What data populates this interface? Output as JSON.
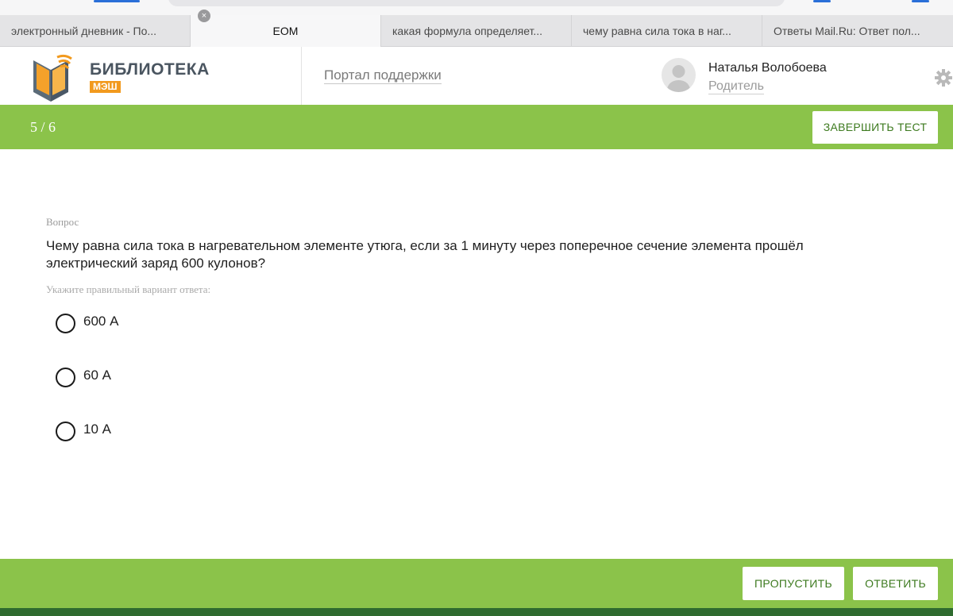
{
  "browser": {
    "tabs": [
      {
        "label": "электронный дневник - По..."
      },
      {
        "label": "ЕОМ"
      },
      {
        "label": "какая формула определяет..."
      },
      {
        "label": "чему равна сила тока в наг..."
      },
      {
        "label": "Ответы Mail.Ru: Ответ пол..."
      }
    ],
    "close_glyph": "×"
  },
  "header": {
    "logo_title": "БИБЛИОТЕКА",
    "logo_subtitle": "МЭШ",
    "support_link": "Портал поддержки",
    "user_name": "Наталья Волобоева",
    "user_role": "Родитель"
  },
  "test": {
    "progress": "5 / 6",
    "finish_label": "ЗАВЕРШИТЬ ТЕСТ"
  },
  "question": {
    "caption": "Вопрос",
    "text": "Чему равна сила тока в нагревательном элементе утюга, если за 1 минуту через поперечное сечение элемента прошёл электрический заряд 600 кулонов?",
    "instruction": "Укажите правильный вариант ответа:",
    "options": [
      {
        "label": "600 А"
      },
      {
        "label": "60 А"
      },
      {
        "label": "10 А"
      }
    ]
  },
  "footer": {
    "skip_label": "ПРОПУСТИТЬ",
    "answer_label": "ОТВЕТИТЬ"
  },
  "colors": {
    "accent_green": "#8bc34a",
    "button_text": "#3d7a1f",
    "logo_orange": "#f29a1e"
  }
}
